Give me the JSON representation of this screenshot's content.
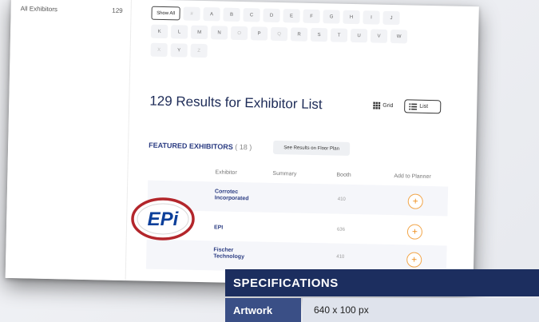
{
  "sidebar": {
    "label": "All Exhibitors",
    "count": "129"
  },
  "alphabet": {
    "show_all": "Show All",
    "row1": [
      "#",
      "A",
      "B",
      "C",
      "D",
      "E",
      "F",
      "G",
      "H",
      "I",
      "J"
    ],
    "row2": [
      "K",
      "L",
      "M",
      "N",
      "O",
      "P",
      "Q",
      "R",
      "S",
      "T",
      "U",
      "V",
      "W"
    ],
    "row3": [
      "X",
      "Y",
      "Z"
    ]
  },
  "results": {
    "title": "129 Results for Exhibitor List",
    "grid_label": "Grid",
    "list_label": "List"
  },
  "featured": {
    "label": "FEATURED EXHIBITORS",
    "count": "( 18 )",
    "floor_plan_button": "See Results on Floor Plan"
  },
  "table": {
    "headers": [
      "Exhibitor",
      "Summary",
      "Booth",
      "Add to Planner"
    ],
    "rows": [
      {
        "name": "Corrotec Incorporated",
        "booth": "410"
      },
      {
        "name": "EPI",
        "booth": "636"
      },
      {
        "name": "Fischer Technology",
        "booth": "410"
      }
    ]
  },
  "logo": {
    "text": "EPi"
  },
  "specs": {
    "title": "SPECIFICATIONS",
    "label": "Artwork",
    "value": "640 x 100 px"
  },
  "colors": {
    "navy": "#1c2e5f",
    "link": "#2b3c82",
    "orange": "#ef8f1d",
    "highlight_ring": "#b3262b"
  }
}
